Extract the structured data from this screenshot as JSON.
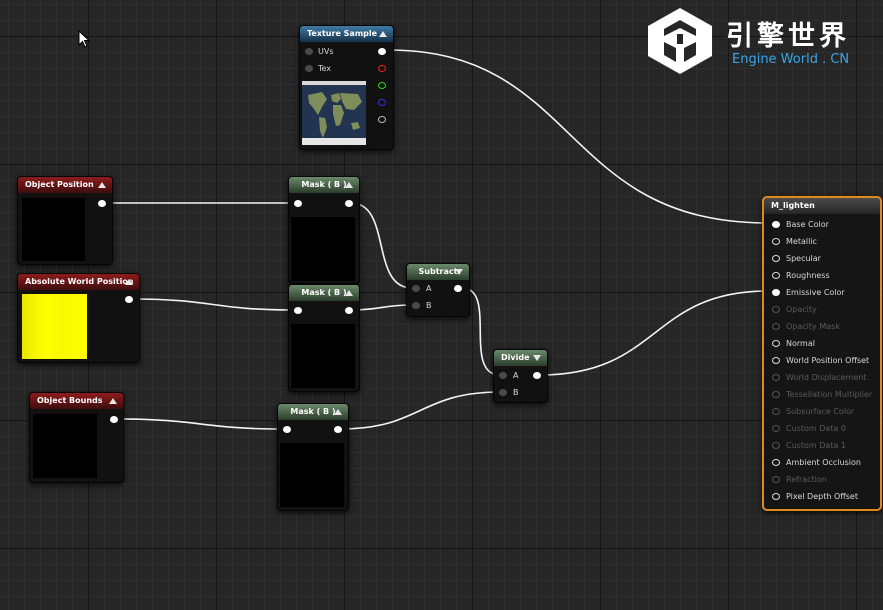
{
  "logo": {
    "cn": "引擎世界",
    "en": "Engine World . CN"
  },
  "nodes": {
    "texture_sample": {
      "title": "Texture Sample",
      "pins": [
        "UVs",
        "Tex"
      ]
    },
    "object_position": {
      "title": "Object Position"
    },
    "absolute_world_position": {
      "title": "Absolute World Position"
    },
    "object_bounds": {
      "title": "Object Bounds"
    },
    "mask1": {
      "title": "Mask ( B )"
    },
    "mask2": {
      "title": "Mask ( B )"
    },
    "mask3": {
      "title": "Mask ( B )"
    },
    "subtract": {
      "title": "Subtract",
      "pins": [
        "A",
        "B"
      ]
    },
    "divide": {
      "title": "Divide",
      "pins": [
        "A",
        "B"
      ]
    }
  },
  "material": {
    "title": "M_lighten",
    "pins": [
      {
        "label": "Base Color",
        "active": true,
        "connected": true
      },
      {
        "label": "Metallic",
        "active": true,
        "connected": false
      },
      {
        "label": "Specular",
        "active": true,
        "connected": false
      },
      {
        "label": "Roughness",
        "active": true,
        "connected": false
      },
      {
        "label": "Emissive Color",
        "active": true,
        "connected": true
      },
      {
        "label": "Opacity",
        "active": false,
        "connected": false
      },
      {
        "label": "Opacity Mask",
        "active": false,
        "connected": false
      },
      {
        "label": "Normal",
        "active": true,
        "connected": false
      },
      {
        "label": "World Position Offset",
        "active": true,
        "connected": false
      },
      {
        "label": "World Displacement",
        "active": false,
        "connected": false
      },
      {
        "label": "Tessellation Multiplier",
        "active": false,
        "connected": false
      },
      {
        "label": "Subsurface Color",
        "active": false,
        "connected": false
      },
      {
        "label": "Custom Data 0",
        "active": false,
        "connected": false
      },
      {
        "label": "Custom Data 1",
        "active": false,
        "connected": false
      },
      {
        "label": "Ambient Occlusion",
        "active": true,
        "connected": false
      },
      {
        "label": "Refraction",
        "active": false,
        "connected": false
      },
      {
        "label": "Pixel Depth Offset",
        "active": true,
        "connected": false
      }
    ]
  },
  "colors": {
    "accent": "#e08a1e",
    "preview_yellow": "#ffff00",
    "wire": "#ffffff"
  }
}
